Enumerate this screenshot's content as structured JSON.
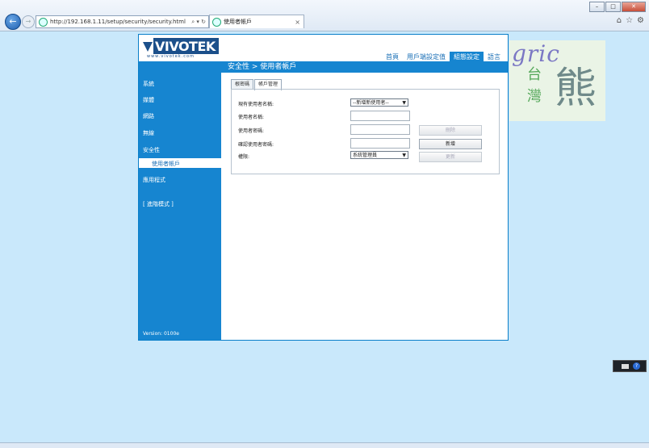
{
  "browser": {
    "url": "http://192.168.1.11/setup/security/security.html",
    "address_tools": "⌕ ▾ ↻",
    "tab_title": "使用者帳戶",
    "tab_close": "×",
    "window_buttons": [
      "–",
      "□",
      "✕"
    ],
    "icons": [
      "home-icon",
      "star-icon",
      "gear-icon"
    ]
  },
  "header": {
    "logo_text": "VIVOTEK",
    "logo_sub": "www.vivotek.com",
    "nav": [
      {
        "label": "首頁",
        "active": false
      },
      {
        "label": "用戶端設定值",
        "active": false
      },
      {
        "label": "組態設定",
        "active": true
      },
      {
        "label": "語言",
        "active": false
      }
    ],
    "breadcrumb": "安全性  > 使用者帳戶"
  },
  "sidebar": {
    "items": [
      "系統",
      "媒體",
      "網路",
      "無線",
      "安全性"
    ],
    "sub_item": "使用者帳戶",
    "after": [
      "應用程式",
      "[ 進階模式 ]"
    ],
    "version": "Version: 0100e"
  },
  "content": {
    "tabs": [
      {
        "label": "根密碼",
        "active": false
      },
      {
        "label": "帳戶管理",
        "active": true
      }
    ],
    "form": {
      "existing_user_label": "現有使用者名稱:",
      "existing_user_value": "--新增新使用者--",
      "username_label": "使用者名稱:",
      "password_label": "使用者密碼:",
      "confirm_label": "確認使用者密碼:",
      "privilege_label": "權限:",
      "privilege_value": "系統管理員",
      "delete_button": "刪除",
      "add_button": "新增",
      "update_button": "更新"
    }
  },
  "watermark": {
    "gric": "gric",
    "tai": "台",
    "wan": "灣",
    "xiong": "熊"
  },
  "colors": {
    "accent": "#1685d0",
    "page_bg": "#c9e8fb"
  }
}
